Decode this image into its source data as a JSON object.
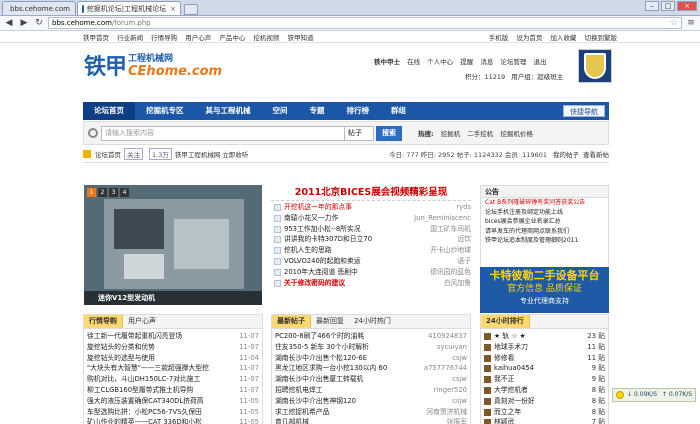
{
  "browser": {
    "tabs": [
      {
        "label": "bbs.cehome.com",
        "active": false
      },
      {
        "label": "挖掘机论坛|工程机械论坛",
        "active": true
      }
    ],
    "url_host": "bbs.cehome.com",
    "url_path": "/forum.php",
    "close_glyph": "×",
    "back_glyph": "◀",
    "forward_glyph": "▶",
    "reload_glyph": "↻",
    "star_glyph": "☆",
    "wrench_glyph": "🔧"
  },
  "topnav": {
    "left": [
      "铁甲首页",
      "行业新闻",
      "行情导购",
      "用户心声",
      "产品中心",
      "挖机视频",
      "铁甲知道"
    ],
    "right": [
      "手机版",
      "设为首页",
      "加入收藏",
      "切换到繁版"
    ]
  },
  "logo": {
    "cn": "铁甲",
    "en_a": "工程机械网",
    "en_b": "CEhome.com"
  },
  "user": {
    "name": "铁中甲士",
    "status": "在线",
    "links": [
      "个人中心",
      "提醒",
      "消息",
      "论坛管理",
      "退出"
    ],
    "points_label": "积分：",
    "points": "11219",
    "group_label": "用户组：",
    "group": "超级斑主"
  },
  "mainnav": {
    "items": [
      "论坛首页",
      "挖掘机专区",
      "其与工程机械",
      "空间",
      "专题",
      "排行榜",
      "群组"
    ],
    "quick": "快捷导航"
  },
  "search": {
    "placeholder": "请输入搜索内容",
    "scope": "帖子",
    "button": "搜索",
    "hot_label": "热搜:",
    "hot": [
      "挖掘机",
      "二手挖机",
      "挖掘机价格"
    ]
  },
  "crumb": {
    "home": "论坛首页",
    "follow": "关注",
    "follow_count": "1.3万",
    "site": "铁甲工程机械网 立即收听",
    "stats": "今日: 777 昨日: 2952 帖子: 1124332 会员: 119601",
    "new_posts": "我的帖子",
    "view_new": "查看新帖"
  },
  "slider": {
    "pages": [
      "1",
      "2",
      "3",
      "4"
    ],
    "active": 0,
    "caption": "迷你V12型发动机"
  },
  "news": {
    "title": "2011北京BICES展会视频精彩呈现",
    "items": [
      {
        "t": "开挖机这一年的那点事",
        "a": "ryds",
        "cls": "red"
      },
      {
        "t": "南辕小花又一力作",
        "a": "Jun_Reminiscenc",
        "cls": ""
      },
      {
        "t": "953工作加小松--8所实况",
        "a": "国工矿车司机",
        "cls": ""
      },
      {
        "t": "讲讲我的卡特307D和日立70",
        "a": "远饮",
        "cls": ""
      },
      {
        "t": "挖机人生的思路",
        "a": "开卡山炒地球",
        "cls": ""
      },
      {
        "t": "VOLVO240的起跑和卖运",
        "a": "语子",
        "cls": ""
      },
      {
        "t": "2010年大连阅道 悲剧中",
        "a": "德讯园的蓝色",
        "cls": ""
      },
      {
        "t": "关于修改密码的建议",
        "a": "白风加鲁",
        "cls": "bold"
      }
    ]
  },
  "notice": {
    "title": "公告",
    "items": [
      "Cat B系列隆破碎锤有奖问答获奖公告",
      "论坛手机注册及绑定功能上线",
      "bices展会参展企业名录汇总",
      "请早发车的代理商网点联系我们",
      "铁甲论坛追本制度及管理细则2011"
    ]
  },
  "ad": {
    "a1": "卡特彼勒二手设备平台",
    "a2": "官方信息 品质保证",
    "a3": "专业代理商支持"
  },
  "panel1": {
    "tabs": [
      "行情导购",
      "用户心声"
    ],
    "items": [
      {
        "t": "徐工新一代履带起重机闪亮登场",
        "d": "11-07"
      },
      {
        "t": "旋挖钻头的分类和优势",
        "d": "11-07"
      },
      {
        "t": "旋挖钻头的选型与使用",
        "d": "11-04"
      },
      {
        "t": "\"大块头有大智慧\"——三款超强撑大型挖",
        "d": "11-07"
      },
      {
        "t": "购机对比，斗山DH150LC-7对比施工",
        "d": "11-07"
      },
      {
        "t": "柳工CLGB160型履带式推土机导购",
        "d": "11-07"
      },
      {
        "t": "强大的液压装置确保CAT340DL挤荷高",
        "d": "11-05"
      },
      {
        "t": "车型选购比拼：小松PC56-7VS久保田",
        "d": "11-05"
      },
      {
        "t": "矿山作业的精英——CAT 336D和小松",
        "d": "11-05"
      }
    ]
  },
  "panel2": {
    "tabs": [
      "最新帖子",
      "最新回复",
      "24小时热门"
    ],
    "items": [
      {
        "t": "PC200-8刷了466个时的油耗",
        "d": "410924837"
      },
      {
        "t": "住友350-5 新车 30个小时解析",
        "d": "sycuiyan"
      },
      {
        "t": "湖南长沙中介出售个松120-6E",
        "d": "csjw"
      },
      {
        "t": "黑龙江地区求购一台小挖130以内 60",
        "d": "a757776744"
      },
      {
        "t": "湖南长沙中介出售厦工转载机",
        "d": "csjw"
      },
      {
        "t": "招聘挖机电焊工",
        "d": "ringer520"
      },
      {
        "t": "湖南长沙中介出售神钢120",
        "d": "csjw"
      },
      {
        "t": "求工挖捉机希产品",
        "d": "河南萧济机械"
      },
      {
        "t": "育几部机械",
        "d": "张振军"
      }
    ]
  },
  "panel3": {
    "tabs": [
      "24小时排行"
    ],
    "items": [
      {
        "t": "★ 轨 ☆ ★",
        "v": "23 贴"
      },
      {
        "t": "地球手术刀",
        "v": "11 贴"
      },
      {
        "t": "修修看",
        "v": "11 贴"
      },
      {
        "t": "kaihua0454",
        "v": "9 贴"
      },
      {
        "t": "我不正",
        "v": "9 贴"
      },
      {
        "t": "大学挖机者",
        "v": "8 贴"
      },
      {
        "t": "真刻对一份好",
        "v": "8 贴"
      },
      {
        "t": "而立之年",
        "v": "8 贴"
      },
      {
        "t": "林颖武",
        "v": "7 贴"
      }
    ]
  },
  "net_speed": {
    "down": "0.09K/S",
    "up": "0.07K/S"
  }
}
